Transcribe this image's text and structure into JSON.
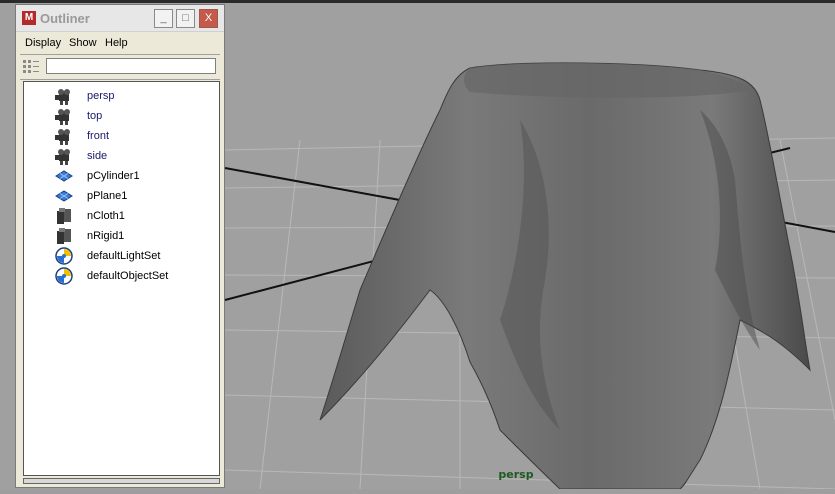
{
  "window": {
    "title": "Outliner",
    "minimize": "_",
    "maximize": "□",
    "close": "X"
  },
  "menu": {
    "display": "Display",
    "show": "Show",
    "help": "Help"
  },
  "filter": {
    "value": ""
  },
  "outliner_items": [
    {
      "label": "persp",
      "icon": "camera-icon"
    },
    {
      "label": "top",
      "icon": "camera-icon"
    },
    {
      "label": "front",
      "icon": "camera-icon"
    },
    {
      "label": "side",
      "icon": "camera-icon"
    },
    {
      "label": "pCylinder1",
      "icon": "mesh-icon"
    },
    {
      "label": "pPlane1",
      "icon": "mesh-icon"
    },
    {
      "label": "nCloth1",
      "icon": "ncloth-icon"
    },
    {
      "label": "nRigid1",
      "icon": "nrigid-icon"
    },
    {
      "label": "defaultLightSet",
      "icon": "set-icon"
    },
    {
      "label": "defaultObjectSet",
      "icon": "set-icon"
    }
  ],
  "viewport": {
    "camera_label": "persp"
  }
}
